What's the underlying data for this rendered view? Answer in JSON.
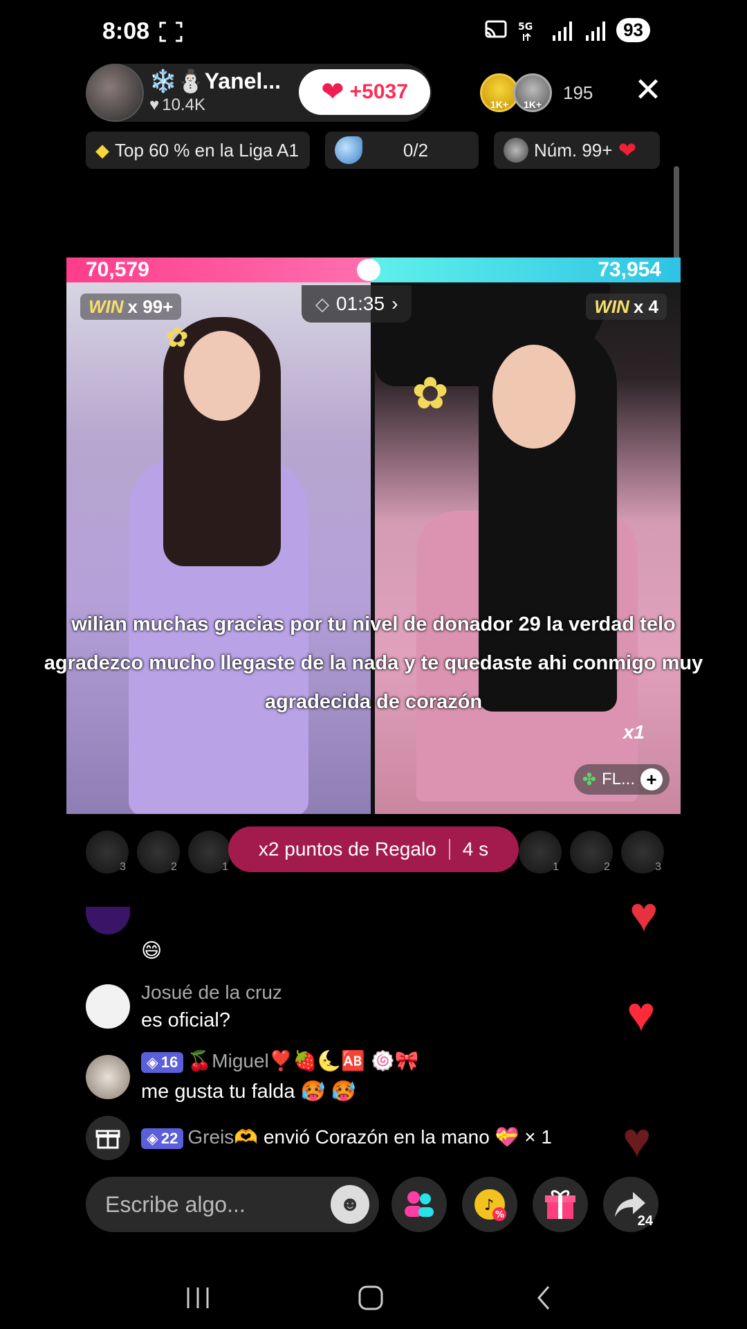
{
  "status_bar": {
    "time": "8:08",
    "battery": "93",
    "network": "5G"
  },
  "header": {
    "host_name": "❄️⛄Yanel...",
    "host_likes": "10.4K",
    "follow_count": "+5037",
    "viewer_badge_1": "1K+",
    "viewer_badge_2": "1K+",
    "viewer_count": "195"
  },
  "info_row": {
    "league": "Top 60 % en la Liga A1",
    "goal": "0/2",
    "rank": "Núm. 99+"
  },
  "battle": {
    "score_left": "70,579",
    "score_right": "73,954",
    "timer": "01:35",
    "win_label": "WIN",
    "win_left_count": "x 99+",
    "win_right_count": "x 4",
    "multiplier": "x1",
    "fl_badge": "FL...",
    "caption": "wilian muchas gracias por tu nivel de donador 29 la verdad telo agradezco mucho  llegaste de la nada y te quedaste ahi conmigo muy agradecida de corazón"
  },
  "bonus": {
    "label": "x2 puntos de Regalo",
    "countdown": "4 s"
  },
  "supporters": {
    "ranks": [
      "3",
      "2",
      "1",
      "1",
      "2",
      "3"
    ]
  },
  "chat": {
    "partial_emoji": "😄",
    "msg1_name": "Josué de la cruz",
    "msg1_text": "es oficial?",
    "msg2_level": "16",
    "msg2_name": "🍒Miguel❣️🍓🌜🆎 🍥🎀",
    "msg2_text": "me gusta tu falda 🥵 🥵",
    "msg3_level": "22",
    "msg3_name": "Greis🫶",
    "msg3_text": "envió Corazón en la mano 💝 × 1"
  },
  "bottom_bar": {
    "comment_placeholder": "Escribe algo...",
    "share_count": "24"
  },
  "colors": {
    "accent": "#fe2c55",
    "score_left": "#ff3d8b",
    "score_right": "#2fc3e4",
    "bonus_bg": "#a31b4d"
  }
}
